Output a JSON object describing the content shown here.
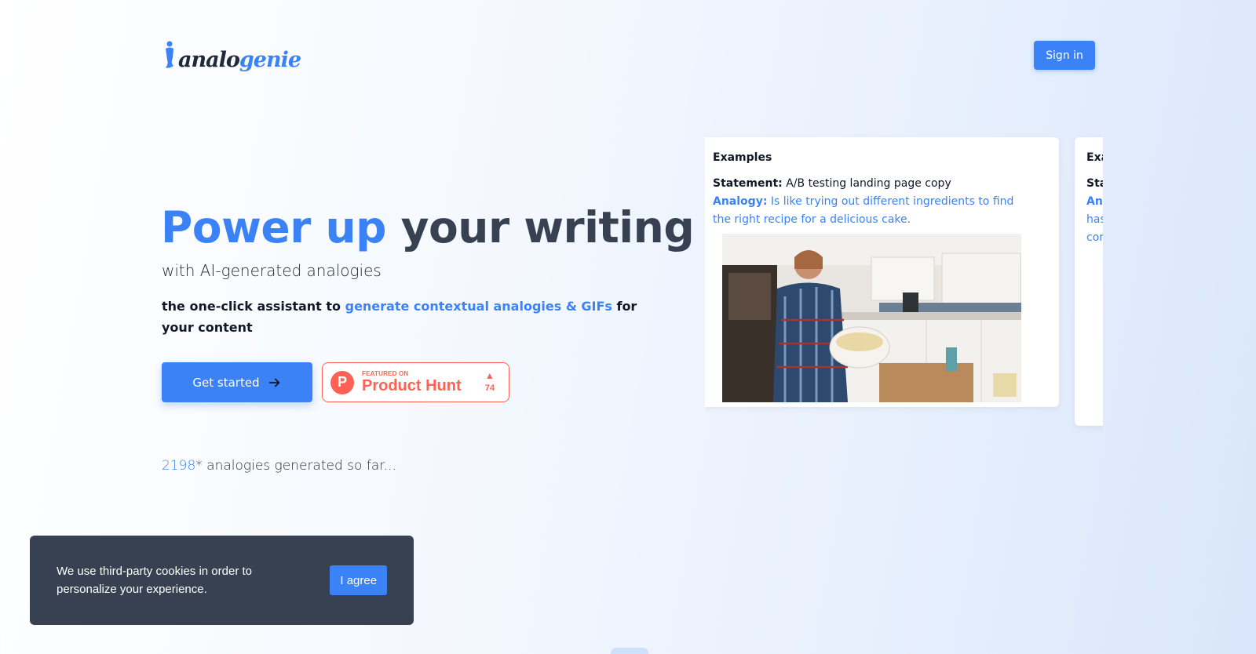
{
  "header": {
    "logo_part1": "analo",
    "logo_part2": "genie",
    "signin_label": "Sign in"
  },
  "hero": {
    "title_accent": "Power up",
    "title_rest": " your writing",
    "subtitle": "with AI-generated analogies",
    "desc_pre": "the one-click assistant to ",
    "desc_highlight": "generate contextual analogies & GIFs",
    "desc_post": " for your content",
    "get_started_label": "Get started"
  },
  "product_hunt": {
    "featured_label": "FEATURED ON",
    "name": "Product Hunt",
    "logo_letter": "P",
    "upvote_icon": "▲",
    "votes": "74"
  },
  "counter": {
    "count": "2198",
    "suffix": "* analogies generated so far..."
  },
  "examples": [
    {
      "title": "Examples",
      "statement_label": "Statement:",
      "statement": " A/B testing landing page copy",
      "analogy_label": "Analogy:",
      "analogy": " Is like trying out different ingredients to find the right recipe for a delicious cake."
    },
    {
      "title": "Exa",
      "statement_label": "Sta",
      "analogy_label": "Ana",
      "analogy_line2": "has",
      "analogy_line3": "con"
    }
  ],
  "cookie": {
    "text": "We use third-party cookies in order to personalize your experience.",
    "agree_label": "I agree"
  },
  "colors": {
    "accent": "#3b82f6",
    "product_hunt": "#ff6154",
    "cookie_bg": "#374151"
  }
}
